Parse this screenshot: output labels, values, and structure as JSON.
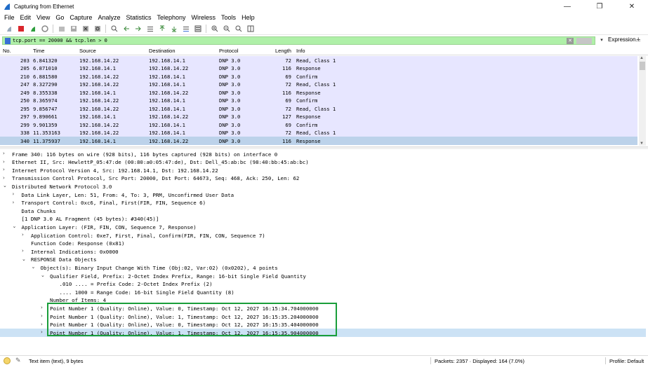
{
  "window": {
    "title": "Capturing from Ethernet",
    "minimize": "—",
    "maximize": "❐",
    "close": "✕"
  },
  "menu": [
    "File",
    "Edit",
    "View",
    "Go",
    "Capture",
    "Analyze",
    "Statistics",
    "Telephony",
    "Wireless",
    "Tools",
    "Help"
  ],
  "filter": {
    "value": "tcp.port == 20000 && tcp.len > 0",
    "expression_label": "Expression...",
    "plus": "+"
  },
  "packet_list": {
    "columns": [
      "No.",
      "Time",
      "Source",
      "Destination",
      "Protocol",
      "Length",
      "Info"
    ],
    "rows": [
      {
        "no": "203",
        "time": "6.841320",
        "src": "192.168.14.22",
        "dst": "192.168.14.1",
        "proto": "DNP 3.0",
        "len": "72",
        "info": "Read, Class 1"
      },
      {
        "no": "205",
        "time": "6.871010",
        "src": "192.168.14.1",
        "dst": "192.168.14.22",
        "proto": "DNP 3.0",
        "len": "116",
        "info": "Response"
      },
      {
        "no": "210",
        "time": "6.881580",
        "src": "192.168.14.22",
        "dst": "192.168.14.1",
        "proto": "DNP 3.0",
        "len": "69",
        "info": "Confirm"
      },
      {
        "no": "247",
        "time": "8.327290",
        "src": "192.168.14.22",
        "dst": "192.168.14.1",
        "proto": "DNP 3.0",
        "len": "72",
        "info": "Read, Class 1"
      },
      {
        "no": "249",
        "time": "8.355338",
        "src": "192.168.14.1",
        "dst": "192.168.14.22",
        "proto": "DNP 3.0",
        "len": "116",
        "info": "Response"
      },
      {
        "no": "250",
        "time": "8.365974",
        "src": "192.168.14.22",
        "dst": "192.168.14.1",
        "proto": "DNP 3.0",
        "len": "69",
        "info": "Confirm"
      },
      {
        "no": "295",
        "time": "9.856747",
        "src": "192.168.14.22",
        "dst": "192.168.14.1",
        "proto": "DNP 3.0",
        "len": "72",
        "info": "Read, Class 1"
      },
      {
        "no": "297",
        "time": "9.890661",
        "src": "192.168.14.1",
        "dst": "192.168.14.22",
        "proto": "DNP 3.0",
        "len": "127",
        "info": "Response"
      },
      {
        "no": "299",
        "time": "9.901359",
        "src": "192.168.14.22",
        "dst": "192.168.14.1",
        "proto": "DNP 3.0",
        "len": "69",
        "info": "Confirm"
      },
      {
        "no": "338",
        "time": "11.353163",
        "src": "192.168.14.22",
        "dst": "192.168.14.1",
        "proto": "DNP 3.0",
        "len": "72",
        "info": "Read, Class 1"
      },
      {
        "no": "340",
        "time": "11.375937",
        "src": "192.168.14.1",
        "dst": "192.168.14.22",
        "proto": "DNP 3.0",
        "len": "116",
        "info": "Response"
      }
    ]
  },
  "details": [
    {
      "level": 0,
      "arrow": ">",
      "text": "Frame 340: 116 bytes on wire (928 bits), 116 bytes captured (928 bits) on interface 0"
    },
    {
      "level": 0,
      "arrow": ">",
      "text": "Ethernet II, Src: HewlettP_05:47:de (00:80:a0:05:47:de), Dst: Dell_45:ab:bc (98:40:bb:45:ab:bc)"
    },
    {
      "level": 0,
      "arrow": ">",
      "text": "Internet Protocol Version 4, Src: 192.168.14.1, Dst: 192.168.14.22"
    },
    {
      "level": 0,
      "arrow": ">",
      "text": "Transmission Control Protocol, Src Port: 20000, Dst Port: 64673, Seq: 468, Ack: 250, Len: 62"
    },
    {
      "level": 0,
      "arrow": "v",
      "text": "Distributed Network Protocol 3.0"
    },
    {
      "level": 1,
      "arrow": ">",
      "text": "Data Link Layer, Len: 51, From: 4, To: 3, PRM, Unconfirmed User Data"
    },
    {
      "level": 1,
      "arrow": ">",
      "text": "Transport Control: 0xc6, Final, First(FIR, FIN, Sequence 6)"
    },
    {
      "level": 1,
      "arrow": "",
      "text": "Data Chunks"
    },
    {
      "level": 1,
      "arrow": "",
      "text": "[1 DNP 3.0 AL Fragment (45 bytes): #340(45)]"
    },
    {
      "level": 1,
      "arrow": "v",
      "text": "Application Layer: (FIR, FIN, CON, Sequence 7, Response)"
    },
    {
      "level": 2,
      "arrow": ">",
      "text": "Application Control: 0xe7, First, Final, Confirm(FIR, FIN, CON, Sequence 7)"
    },
    {
      "level": 2,
      "arrow": "",
      "text": "Function Code: Response (0x81)"
    },
    {
      "level": 2,
      "arrow": ">",
      "text": "Internal Indications: 0x0000"
    },
    {
      "level": 2,
      "arrow": "v",
      "text": "RESPONSE Data Objects"
    },
    {
      "level": 3,
      "arrow": "v",
      "text": "Object(s): Binary Input Change With Time (Obj:02, Var:02) (0x0202), 4 points"
    },
    {
      "level": 4,
      "arrow": "v",
      "text": "Qualifier Field, Prefix: 2-Octet Index Prefix, Range: 16-bit Single Field Quantity"
    },
    {
      "level": 5,
      "arrow": "",
      "text": ".010 .... = Prefix Code: 2-Octet Index Prefix (2)"
    },
    {
      "level": 5,
      "arrow": "",
      "text": ".... 1000 = Range Code: 16-bit Single Field Quantity (8)"
    },
    {
      "level": 4,
      "arrow": "",
      "text": "Number of Items: 4"
    },
    {
      "level": 4,
      "arrow": ">",
      "text": "Point Number 1 (Quality: Online), Value: 0, Timestamp: Oct 12, 2027 16:15:34.704000000"
    },
    {
      "level": 4,
      "arrow": ">",
      "text": "Point Number 1 (Quality: Online), Value: 1, Timestamp: Oct 12, 2027 16:15:35.204000000"
    },
    {
      "level": 4,
      "arrow": ">",
      "text": "Point Number 1 (Quality: Online), Value: 0, Timestamp: Oct 12, 2027 16:15:35.404000000"
    },
    {
      "level": 4,
      "arrow": ">",
      "text": "Point Number 1 (Quality: Online), Value: 1, Timestamp: Oct 12, 2027 16:15:35.904000000"
    }
  ],
  "status": {
    "text": "Text item (text), 9 bytes",
    "packets": "Packets: 2357 · Displayed: 164 (7.0%)",
    "profile": "Profile: Default"
  },
  "colors": {
    "row_bg": "#e7e6ff",
    "row_selected": "#bcd2ea",
    "filter_ok": "#aff0a8",
    "highlight_box": "#1a9e3a"
  }
}
